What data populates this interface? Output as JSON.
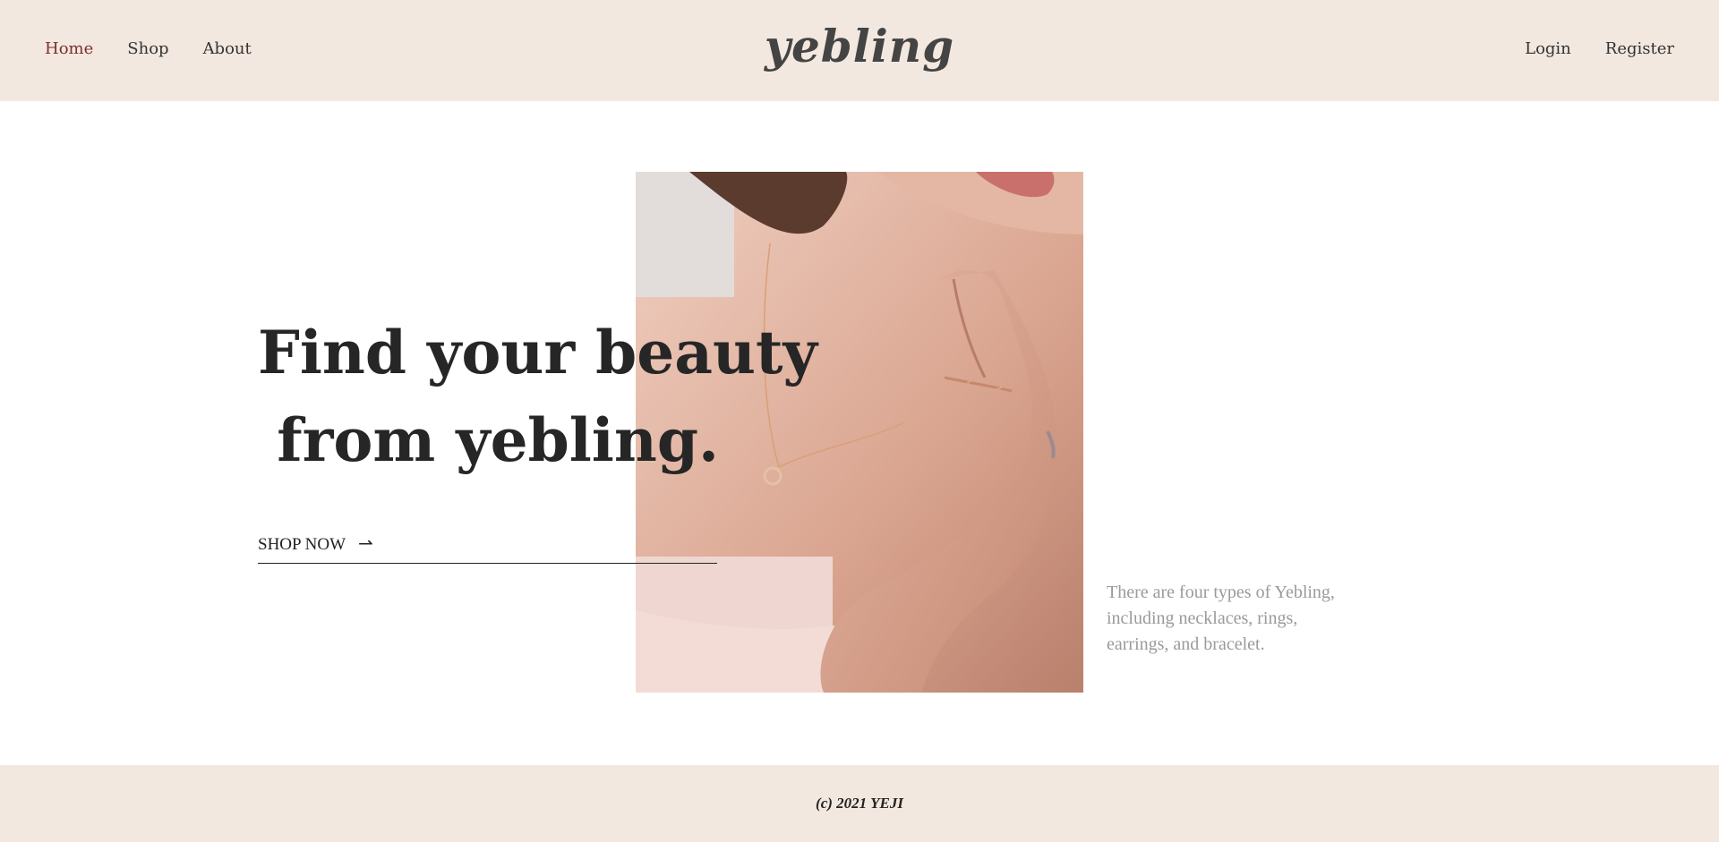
{
  "header": {
    "logo": "yebling",
    "nav_left": [
      {
        "label": "Home",
        "active": true
      },
      {
        "label": "Shop",
        "active": false
      },
      {
        "label": "About",
        "active": false
      }
    ],
    "nav_right": [
      {
        "label": "Login"
      },
      {
        "label": "Register"
      }
    ]
  },
  "hero": {
    "headline_line1": "Find your beauty",
    "headline_line2": "from yebling.",
    "cta_label": "SHOP NOW",
    "cta_icon": "arrow-right-icon",
    "description_line1": "There are four types of Yebling,",
    "description_line2": "including necklaces, rings, earrings, and bracelet."
  },
  "footer": {
    "copyright": "(c) 2021 YEJI"
  },
  "colors": {
    "header_bg": "#f3e8e0",
    "active_nav": "#7b2e2e",
    "description_text": "#9a9a9a"
  }
}
